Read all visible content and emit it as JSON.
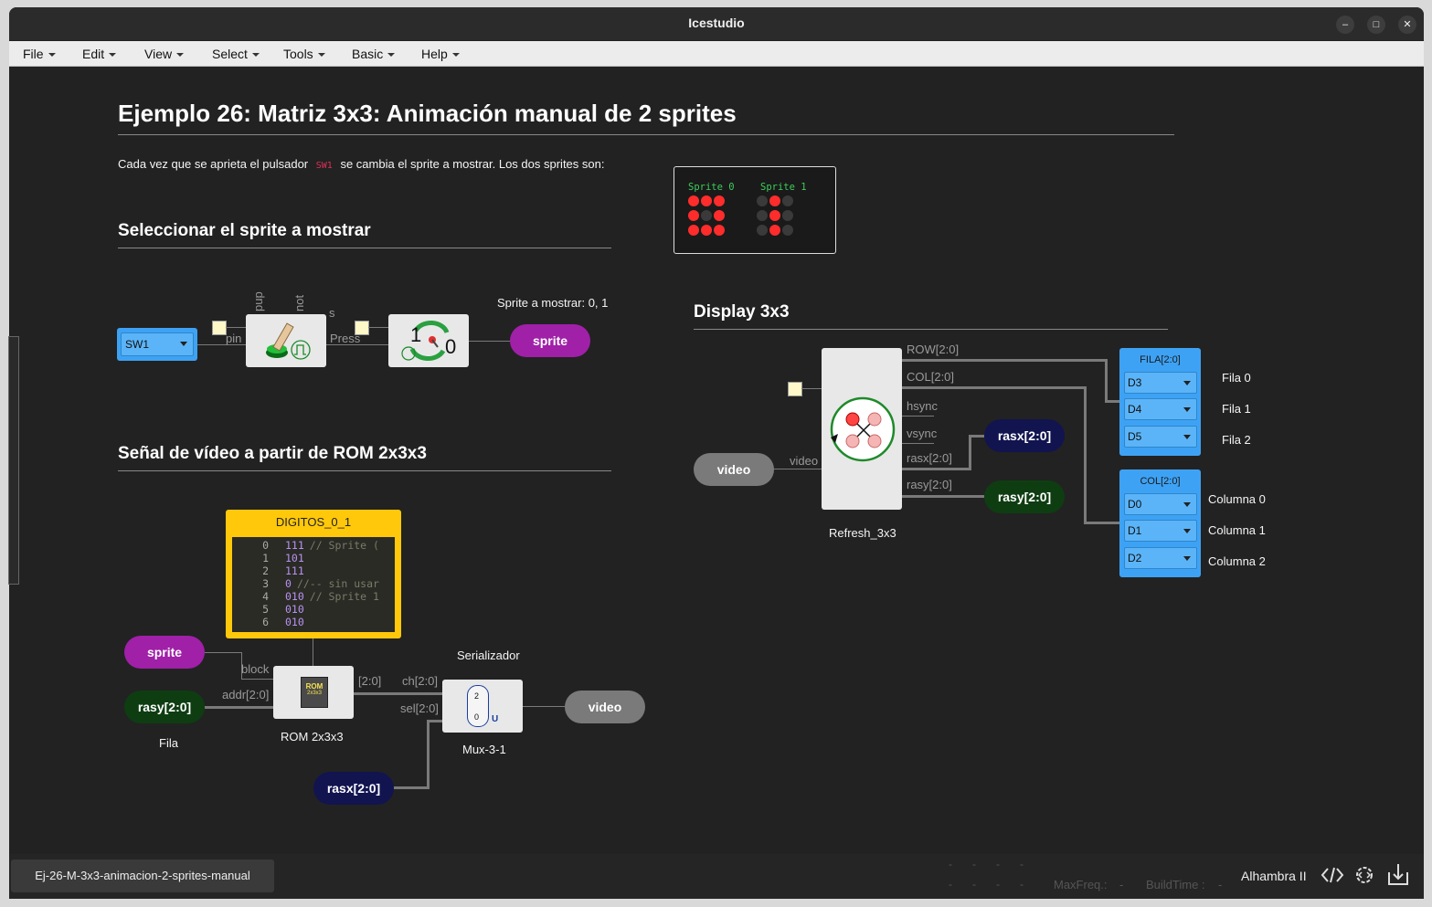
{
  "window": {
    "title": "Icestudio"
  },
  "menubar": [
    "File",
    "Edit",
    "View",
    "Select",
    "Tools",
    "Basic",
    "Help"
  ],
  "canvas": {
    "heading": "Ejemplo 26: Matriz 3x3: Animación manual de 2 sprites",
    "intro_before": "Cada vez que se aprieta el pulsador",
    "intro_code": "SW1",
    "intro_after": "se cambia el sprite a mostrar. Los dos sprites son:",
    "sprites_box": {
      "label0": "Sprite 0",
      "label1": "Sprite 1"
    },
    "section1": "Seleccionar el sprite a mostrar",
    "section2": "Señal de vídeo a partir de ROM 2x3x3",
    "section3": "Display 3x3",
    "sprite_note": "Sprite a mostrar: 0, 1",
    "sw1_select": "SW1",
    "button_ports": {
      "pup": "pup",
      "not": "not",
      "s": "s",
      "pin": "pin",
      "press": "Press"
    },
    "toggle_numbers": {
      "one": "1",
      "zero": "0"
    },
    "labels": {
      "sprite": "sprite",
      "sprite2": "sprite",
      "video_out": "video",
      "video_in": "video",
      "rasy": "rasy[2:0]",
      "rasx": "rasx[2:0]",
      "rasx_right": "rasx[2:0]",
      "rasy_right": "rasy[2:0]"
    },
    "memory": {
      "title": "DIGITOS_0_1",
      "lines": [
        {
          "n": "0",
          "code": "111",
          "comment": "// Sprite ("
        },
        {
          "n": "1",
          "code": "101",
          "comment": ""
        },
        {
          "n": "2",
          "code": "111",
          "comment": ""
        },
        {
          "n": "3",
          "code": "0",
          "comment": "//-- sin usar"
        },
        {
          "n": "4",
          "code": "010",
          "comment": "// Sprite 1"
        },
        {
          "n": "5",
          "code": "010",
          "comment": ""
        },
        {
          "n": "6",
          "code": "010",
          "comment": ""
        }
      ]
    },
    "rom": {
      "name": "ROM 2x3x3",
      "port_block": "block",
      "port_addr": "addr[2:0]",
      "port_out": "[2:0]",
      "chip_text": "ROM",
      "chip_sub": "2x3x3"
    },
    "fila_label": "Fila",
    "serializer": "Serializador",
    "mux": {
      "name": "Mux-3-1",
      "port_ch": "ch[2:0]",
      "port_sel": "sel[2:0]",
      "top": "2",
      "bottom": "0",
      "u": "U"
    },
    "refresh": {
      "name": "Refresh_3x3",
      "ports": {
        "row": "ROW[2:0]",
        "col": "COL[2:0]",
        "hsync": "hsync",
        "vsync": "vsync",
        "rasx": "rasx[2:0]",
        "rasy": "rasy[2:0]",
        "video": "video"
      }
    },
    "fila_block": {
      "title": "FILA[2:0]",
      "options": [
        "D3",
        "D4",
        "D5"
      ],
      "names": [
        "Fila 0",
        "Fila 1",
        "Fila 2"
      ]
    },
    "col_block": {
      "title": "COL[2:0]",
      "options": [
        "D0",
        "D1",
        "D2"
      ],
      "names": [
        "Columna 0",
        "Columna 1",
        "Columna 2"
      ]
    }
  },
  "statusbar": {
    "file_tab": "Ej-26-M-3x3-animacion-2-sprites-manual",
    "dashes": "-",
    "maxfreq": "MaxFreq.:",
    "maxfreq_val": "-",
    "buildtime": "BuildTime :",
    "buildtime_val": "-",
    "board": "Alhambra II"
  },
  "colors": {
    "accent_blue": "#3ea2f4",
    "purple": "#a020a8",
    "dark_green": "#0e3d12",
    "navy": "#121450",
    "gray": "#7a7a7a",
    "memory_border": "#ffc80a",
    "led_on": "#ff2c2c",
    "led_off": "#3a3a3a"
  },
  "sprite_pattern": {
    "sprite0": [
      [
        1,
        1,
        1
      ],
      [
        1,
        0,
        1
      ],
      [
        1,
        1,
        1
      ]
    ],
    "sprite1": [
      [
        0,
        1,
        0
      ],
      [
        0,
        1,
        0
      ],
      [
        0,
        1,
        0
      ]
    ]
  }
}
